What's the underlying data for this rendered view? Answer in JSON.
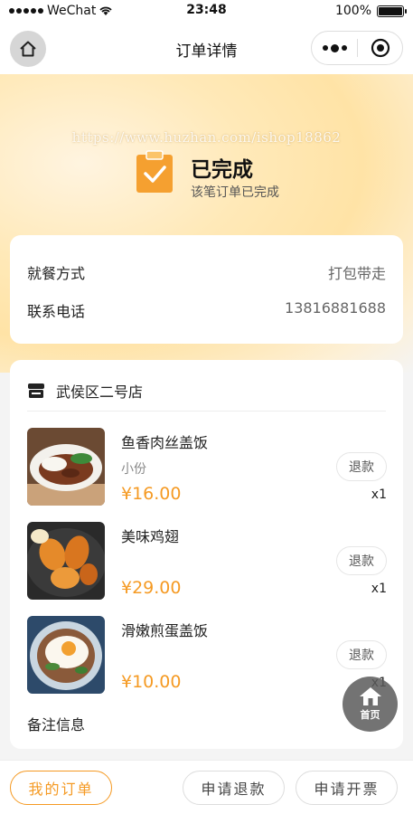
{
  "status_bar": {
    "carrier": "WeChat",
    "time": "23:48",
    "battery": "100%"
  },
  "nav": {
    "title": "订单详情"
  },
  "watermark": "https://www.huzhan.com/ishop18862",
  "order_status": {
    "title": "已完成",
    "subtitle": "该笔订单已完成"
  },
  "info": {
    "rows": [
      {
        "label": "就餐方式",
        "value": "打包带走"
      },
      {
        "label": "联系电话",
        "value": "13816881688"
      }
    ]
  },
  "store": {
    "name": "武侯区二号店",
    "items": [
      {
        "name": "鱼香肉丝盖饭",
        "spec": "小份",
        "price": "¥16.00",
        "refund": "退款",
        "qty": "x1"
      },
      {
        "name": "美味鸡翅",
        "spec": "",
        "price": "¥29.00",
        "refund": "退款",
        "qty": "x1"
      },
      {
        "name": "滑嫩煎蛋盖饭",
        "spec": "",
        "price": "¥10.00",
        "refund": "退款",
        "qty": "x1"
      }
    ],
    "remark_label": "备注信息"
  },
  "float_home": {
    "label": "首页",
    "icon": "house-icon"
  },
  "bottom": {
    "my_orders": "我的订单",
    "request_refund": "申请退款",
    "request_invoice": "申请开票"
  },
  "colors": {
    "accent": "#f59a23",
    "hero": "#ffe3a6"
  }
}
